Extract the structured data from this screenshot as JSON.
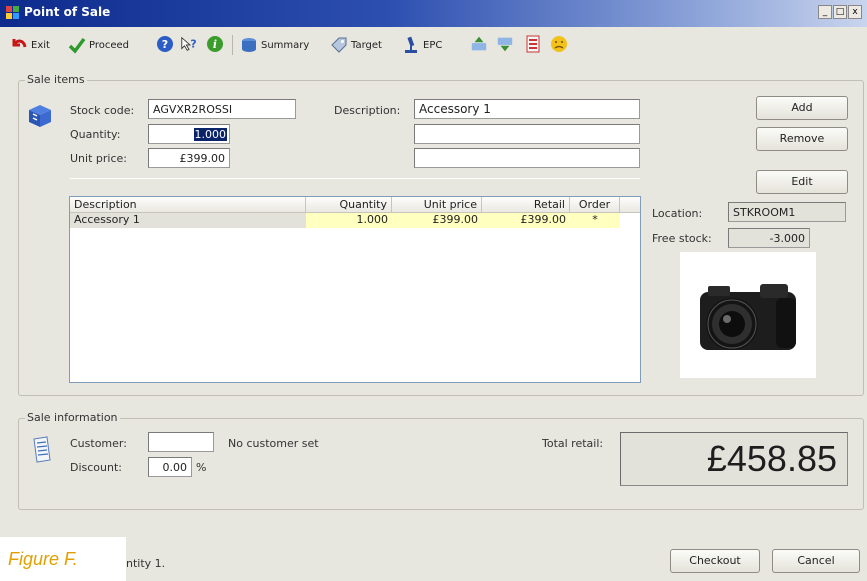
{
  "window": {
    "title": "Point of Sale",
    "minimize": "_",
    "maximize": "□",
    "close": "x"
  },
  "toolbar": {
    "exit": "Exit",
    "proceed": "Proceed",
    "summary": "Summary",
    "target": "Target",
    "epc": "EPC"
  },
  "sale_items": {
    "group_label": "Sale items",
    "stock_code_label": "Stock code:",
    "stock_code": "AGVXR2ROSSI",
    "quantity_label": "Quantity:",
    "quantity": "1.000",
    "unit_price_label": "Unit price:",
    "unit_price": "£399.00",
    "description_label": "Description:",
    "description_lines": [
      "Accessory 1",
      "",
      ""
    ],
    "buttons": {
      "add": "Add",
      "remove": "Remove",
      "edit": "Edit"
    },
    "location_label": "Location:",
    "location": "STKROOM1",
    "free_stock_label": "Free stock:",
    "free_stock": "-3.000",
    "table": {
      "columns": [
        "Description",
        "Quantity",
        "Unit price",
        "Retail",
        "Order"
      ],
      "rows": [
        {
          "description": "Accessory 1",
          "quantity": "1.000",
          "unit_price": "£399.00",
          "retail": "£399.00",
          "order": "*"
        }
      ]
    }
  },
  "sale_information": {
    "group_label": "Sale information",
    "customer_label": "Customer:",
    "customer": "",
    "customer_status": "No customer set",
    "discount_label": "Discount:",
    "discount": "0.00",
    "discount_unit": "%",
    "total_retail_label": "Total retail:",
    "total_retail": "£458.85"
  },
  "status_bar": {
    "text": "ntity 1."
  },
  "footer_buttons": {
    "checkout": "Checkout",
    "cancel": "Cancel"
  },
  "caption": "Figure F.",
  "colors": {
    "title_bar": "#0d2b8c",
    "highlight_row": "#ffffc0",
    "selection": "#0a246a"
  }
}
